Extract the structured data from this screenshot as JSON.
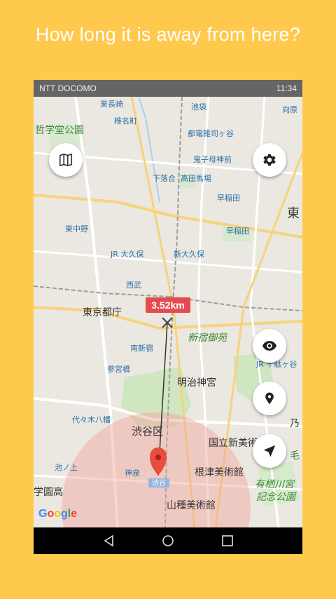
{
  "headline": "How long it is away from here?",
  "status": {
    "carrier": "NTT DOCOMO",
    "time": "11:34"
  },
  "distance_label": "3.52km",
  "attribution": "Google",
  "map_labels": {
    "higashi_ikebukuro": "東長崎",
    "shiinamachi": "椎名町",
    "ikebukuro": "池袋",
    "mukohara": "向原",
    "tetsugakudo": "哲学堂公園",
    "zoshigaya": "都電雑司ヶ谷",
    "kishibojin": "鬼子母神前",
    "shimoochiai": "下落合",
    "takadanobaba": "高田馬場",
    "waseda": "早稲田",
    "higashi": "東",
    "higashinakano": "東中野",
    "nishiwaseda": "早稲田",
    "jr_okubo": "JR 大久保",
    "shin_okubo": "新大久保",
    "seibu": "西武",
    "tocho": "東京都庁",
    "minami_shinjuku": "南新宿",
    "shinjuku_gyoen": "新宿御苑",
    "sangubashi": "参宮橋",
    "meiji_jingu": "明治神宮",
    "jr_sendagaya": "JR 千駄ヶ谷",
    "yoyogi_hachiman": "代々木八幡",
    "shibuya_ku": "渋谷区",
    "kokuritsu": "国立新美術",
    "nogizaka": "乃",
    "ikenoue": "池ノ上",
    "shinsen": "神泉",
    "shibuya": "渋谷",
    "nezu": "根津美術館",
    "arisugawa": "有栖川宮",
    "kinenkoen": "記念公園",
    "gakuen": "学園高",
    "yamatane": "山種美術館",
    "yama": "毛"
  },
  "buttons": {
    "map": "map-icon",
    "settings": "gear-icon",
    "visibility": "eye-icon",
    "pin": "location-pin-icon",
    "locate": "navigation-arrow-icon"
  }
}
